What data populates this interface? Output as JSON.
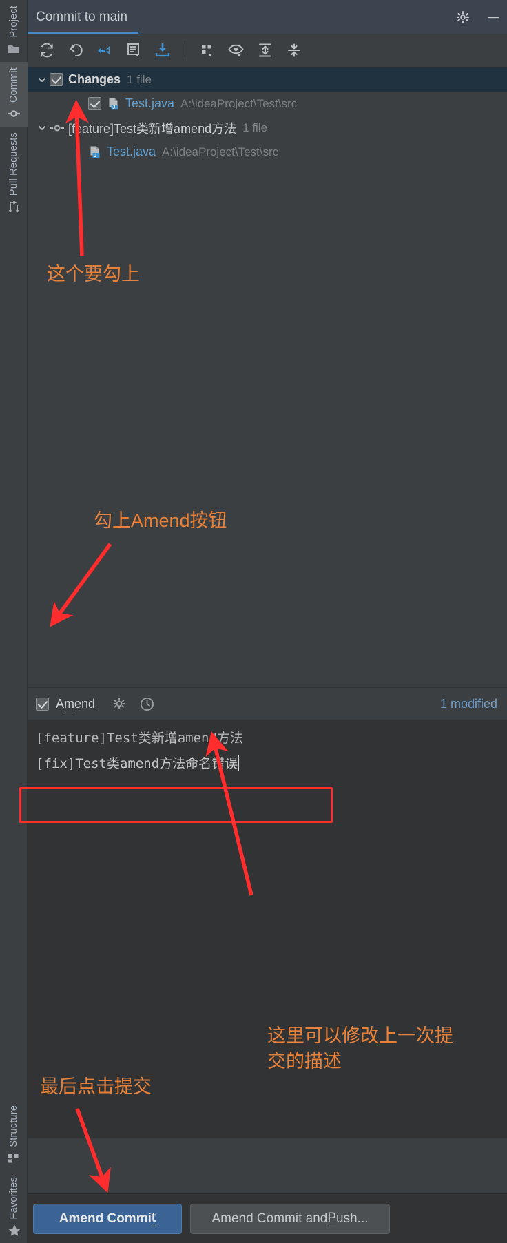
{
  "window": {
    "tab_label": "Commit to main",
    "gear_icon": "gear-icon",
    "minimize_icon": "minimize-icon"
  },
  "rail": {
    "top_items": [
      {
        "label": "Project",
        "icon": "folder-icon",
        "active": false
      },
      {
        "label": "Commit",
        "icon": "commit-node-icon",
        "active": true
      },
      {
        "label": "Pull Requests",
        "icon": "pull-request-icon",
        "active": false
      }
    ],
    "bottom_items": [
      {
        "label": "Structure",
        "icon": "structure-icon",
        "active": false
      },
      {
        "label": "Favorites",
        "icon": "star-icon",
        "active": false
      }
    ]
  },
  "toolbar": {
    "buttons": [
      {
        "name": "refresh-changes-icon",
        "title": "Refresh Changes"
      },
      {
        "name": "rollback-icon",
        "title": "Rollback"
      },
      {
        "name": "shelve-silently-icon",
        "title": "Shelve Silently"
      },
      {
        "name": "show-diff-icon",
        "title": "Show Diff"
      },
      {
        "name": "get-from-vcs-icon",
        "title": "Update Project"
      },
      {
        "name": "group-by-icon",
        "title": "Group By"
      },
      {
        "name": "preview-diff-icon",
        "title": "Preview Diff"
      },
      {
        "name": "expand-all-icon",
        "title": "Expand All"
      },
      {
        "name": "collapse-all-icon",
        "title": "Collapse All"
      }
    ]
  },
  "changes": {
    "root": {
      "title": "Changes",
      "count_label": "1 file",
      "checked": true,
      "expanded": true
    },
    "root_files": [
      {
        "checked": true,
        "name": "Test.java",
        "path": "A:\\ideaProject\\Test\\src",
        "icon": "java-file-icon"
      }
    ],
    "commit_node": {
      "title": "[feature]Test类新增amend方法",
      "count_label": "1 file",
      "expanded": true,
      "icon": "git-commit-icon"
    },
    "commit_files": [
      {
        "name": "Test.java",
        "path": "A:\\ideaProject\\Test\\src",
        "icon": "java-file-icon"
      }
    ]
  },
  "amend_bar": {
    "checkbox_checked": true,
    "label_prefix": "A",
    "label_mnemonic": "m",
    "label_suffix": "end",
    "gear_icon": "gear-icon",
    "history_icon": "clock-history-icon",
    "status": "1 modified"
  },
  "message": {
    "previous_line": "[feature]Test类新增amend方法",
    "current_line": "[fix]Test类amend方法命名错误"
  },
  "buttons": {
    "primary": {
      "prefix": "Amend Commi",
      "mnemonic": "t",
      "suffix": ""
    },
    "secondary": {
      "prefix": "Amend Commit and ",
      "mnemonic": "P",
      "suffix": "ush..."
    }
  },
  "annotations": {
    "accent_color": "#e8823a",
    "arrow_color": "#ff2d2d",
    "items": [
      {
        "text": "这个要勾上"
      },
      {
        "text": "勾上Amend按钮"
      },
      {
        "text": "这里可以修改上一次提\n交的描述"
      },
      {
        "text": "最后点击提交"
      }
    ]
  }
}
